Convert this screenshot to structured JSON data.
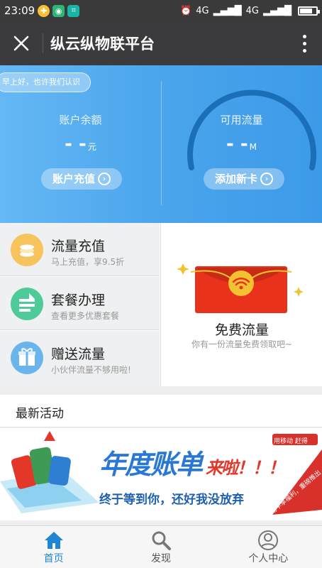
{
  "status_bar": {
    "time": "23:09",
    "network": "4G",
    "network2": "4G"
  },
  "header": {
    "title": "纵云纵物联平台"
  },
  "hero": {
    "greeting": "早上好，也许我们认识",
    "balance_label": "账户余额",
    "balance_value": "- -",
    "balance_unit": "元",
    "balance_button": "账户充值",
    "traffic_label": "可用流量",
    "traffic_value": "- -",
    "traffic_unit": "M",
    "traffic_button": "添加新卡"
  },
  "menu": {
    "items": [
      {
        "title": "流量充值",
        "subtitle": "马上充值，享9.5折"
      },
      {
        "title": "套餐办理",
        "subtitle": "查看更多优惠套餐"
      },
      {
        "title": "赠送流量",
        "subtitle": "小伙伴流量不够用啦!"
      }
    ],
    "free": {
      "title": "免费流量",
      "subtitle": "你有一份流量免费领取吧~"
    }
  },
  "activities": {
    "title": "最新活动",
    "banner": {
      "headline": "年度账单",
      "headline2": "来啦！！！",
      "slogan": "终于等到你，还好我没放弃",
      "badge": "用移动 赶得",
      "corner": "用卡享福利，重磅推出"
    }
  },
  "tabs": [
    {
      "label": "首页",
      "icon": "home-icon"
    },
    {
      "label": "发现",
      "icon": "search-icon"
    },
    {
      "label": "个人中心",
      "icon": "user-icon"
    }
  ],
  "colors": {
    "accent": "#1f86d6",
    "hero": "#4aa5ec",
    "title_bar": "#3b3b3d"
  }
}
